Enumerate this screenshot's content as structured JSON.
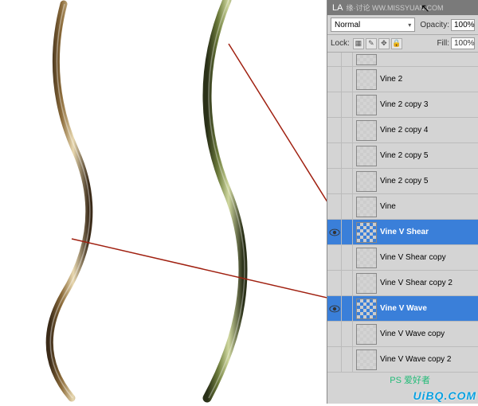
{
  "panel": {
    "tab": "LA",
    "header_text": "缘·讨论 WW.MISSYUAN.COM",
    "blend_mode": "Normal",
    "opacity_label": "Opacity:",
    "opacity_value": "100%",
    "lock_label": "Lock:",
    "fill_label": "Fill:",
    "fill_value": "100%"
  },
  "layers": [
    {
      "name": "Vine 2",
      "visible": false,
      "selected": false
    },
    {
      "name": "Vine 2 copy 3",
      "visible": false,
      "selected": false
    },
    {
      "name": "Vine 2 copy 4",
      "visible": false,
      "selected": false
    },
    {
      "name": "Vine 2 copy 5",
      "visible": false,
      "selected": false
    },
    {
      "name": "Vine 2 copy 5",
      "visible": false,
      "selected": false
    },
    {
      "name": "Vine",
      "visible": false,
      "selected": false
    },
    {
      "name": "Vine V Shear",
      "visible": true,
      "selected": true
    },
    {
      "name": "Vine V Shear copy",
      "visible": false,
      "selected": false
    },
    {
      "name": "Vine V Shear copy 2",
      "visible": false,
      "selected": false
    },
    {
      "name": "Vine V Wave",
      "visible": true,
      "selected": true
    },
    {
      "name": "Vine V Wave copy",
      "visible": false,
      "selected": false
    },
    {
      "name": "Vine V Wave copy 2",
      "visible": false,
      "selected": false
    }
  ],
  "watermark": "UiBQ.COM",
  "watermark2": "PS 爱好者"
}
